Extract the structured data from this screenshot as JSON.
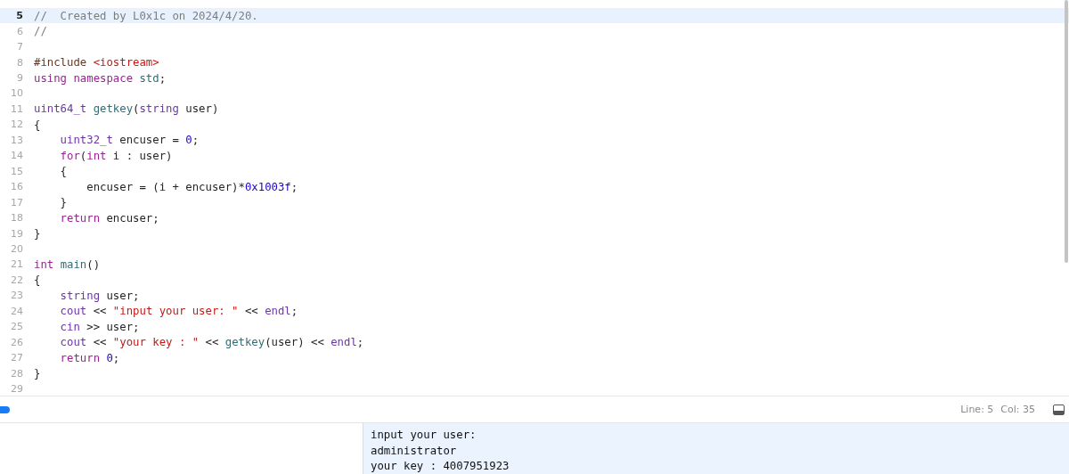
{
  "editor": {
    "lines": [
      {
        "number": "5",
        "current": true,
        "tokens": [
          {
            "kind": "comment",
            "text": "//  Created by L0x1c on 2024/4/20."
          }
        ]
      },
      {
        "number": "6",
        "current": false,
        "tokens": [
          {
            "kind": "comment",
            "text": "//"
          }
        ]
      },
      {
        "number": "7",
        "current": false
      },
      {
        "number": "8",
        "current": false,
        "tokens": [
          {
            "kind": "preproc",
            "text": "#include "
          },
          {
            "kind": "string",
            "text": "<iostream>"
          }
        ]
      },
      {
        "number": "9",
        "current": false,
        "tokens": [
          {
            "kind": "keyword",
            "text": "using namespace "
          },
          {
            "kind": "func",
            "text": "std"
          },
          {
            "kind": "plain",
            "text": ";"
          }
        ]
      },
      {
        "number": "10",
        "current": false
      },
      {
        "number": "11",
        "current": false,
        "tokens": [
          {
            "kind": "type",
            "text": "uint64_t "
          },
          {
            "kind": "func",
            "text": "getkey"
          },
          {
            "kind": "plain",
            "text": "("
          },
          {
            "kind": "type",
            "text": "string"
          },
          {
            "kind": "plain",
            "text": " user)"
          }
        ]
      },
      {
        "number": "12",
        "current": false,
        "tokens": [
          {
            "kind": "plain",
            "text": "{"
          }
        ]
      },
      {
        "number": "13",
        "current": false,
        "tokens": [
          {
            "kind": "type",
            "text": "    uint32_t"
          },
          {
            "kind": "plain",
            "text": " encuser = "
          },
          {
            "kind": "number",
            "text": "0"
          },
          {
            "kind": "plain",
            "text": ";"
          }
        ]
      },
      {
        "number": "14",
        "current": false,
        "tokens": [
          {
            "kind": "keyword",
            "text": "    for"
          },
          {
            "kind": "plain",
            "text": "("
          },
          {
            "kind": "keyword",
            "text": "int"
          },
          {
            "kind": "plain",
            "text": " i : user)"
          }
        ]
      },
      {
        "number": "15",
        "current": false,
        "tokens": [
          {
            "kind": "plain",
            "text": "    {"
          }
        ]
      },
      {
        "number": "16",
        "current": false,
        "tokens": [
          {
            "kind": "plain",
            "text": "        encuser = (i + encuser)*"
          },
          {
            "kind": "number",
            "text": "0x1003f"
          },
          {
            "kind": "plain",
            "text": ";"
          }
        ]
      },
      {
        "number": "17",
        "current": false,
        "tokens": [
          {
            "kind": "plain",
            "text": "    }"
          }
        ]
      },
      {
        "number": "18",
        "current": false,
        "tokens": [
          {
            "kind": "keyword",
            "text": "    return"
          },
          {
            "kind": "plain",
            "text": " encuser;"
          }
        ]
      },
      {
        "number": "19",
        "current": false,
        "tokens": [
          {
            "kind": "plain",
            "text": "}"
          }
        ]
      },
      {
        "number": "20",
        "current": false
      },
      {
        "number": "21",
        "current": false,
        "tokens": [
          {
            "kind": "keyword",
            "text": "int "
          },
          {
            "kind": "func",
            "text": "main"
          },
          {
            "kind": "plain",
            "text": "()"
          }
        ]
      },
      {
        "number": "22",
        "current": false,
        "tokens": [
          {
            "kind": "plain",
            "text": "{"
          }
        ]
      },
      {
        "number": "23",
        "current": false,
        "tokens": [
          {
            "kind": "type",
            "text": "    string"
          },
          {
            "kind": "plain",
            "text": " user;"
          }
        ]
      },
      {
        "number": "24",
        "current": false,
        "tokens": [
          {
            "kind": "type",
            "text": "    cout"
          },
          {
            "kind": "plain",
            "text": " << "
          },
          {
            "kind": "string",
            "text": "\"input your user: \""
          },
          {
            "kind": "plain",
            "text": " << "
          },
          {
            "kind": "type",
            "text": "endl"
          },
          {
            "kind": "plain",
            "text": ";"
          }
        ]
      },
      {
        "number": "25",
        "current": false,
        "tokens": [
          {
            "kind": "type",
            "text": "    cin"
          },
          {
            "kind": "plain",
            "text": " >> user;"
          }
        ]
      },
      {
        "number": "26",
        "current": false,
        "tokens": [
          {
            "kind": "type",
            "text": "    cout"
          },
          {
            "kind": "plain",
            "text": " << "
          },
          {
            "kind": "string",
            "text": "\"your key : \""
          },
          {
            "kind": "plain",
            "text": " << "
          },
          {
            "kind": "func",
            "text": "getkey"
          },
          {
            "kind": "plain",
            "text": "(user) << "
          },
          {
            "kind": "type",
            "text": "endl"
          },
          {
            "kind": "plain",
            "text": ";"
          }
        ]
      },
      {
        "number": "27",
        "current": false,
        "tokens": [
          {
            "kind": "keyword",
            "text": "    return "
          },
          {
            "kind": "number",
            "text": "0"
          },
          {
            "kind": "plain",
            "text": ";"
          }
        ]
      },
      {
        "number": "28",
        "current": false,
        "tokens": [
          {
            "kind": "plain",
            "text": "}"
          }
        ]
      },
      {
        "number": "29",
        "current": false
      }
    ]
  },
  "status_bar": {
    "line": "Line: 5",
    "column": "Col: 35"
  },
  "console": {
    "output": [
      "input your user:",
      "administrator",
      "your key : 4007951923"
    ]
  }
}
